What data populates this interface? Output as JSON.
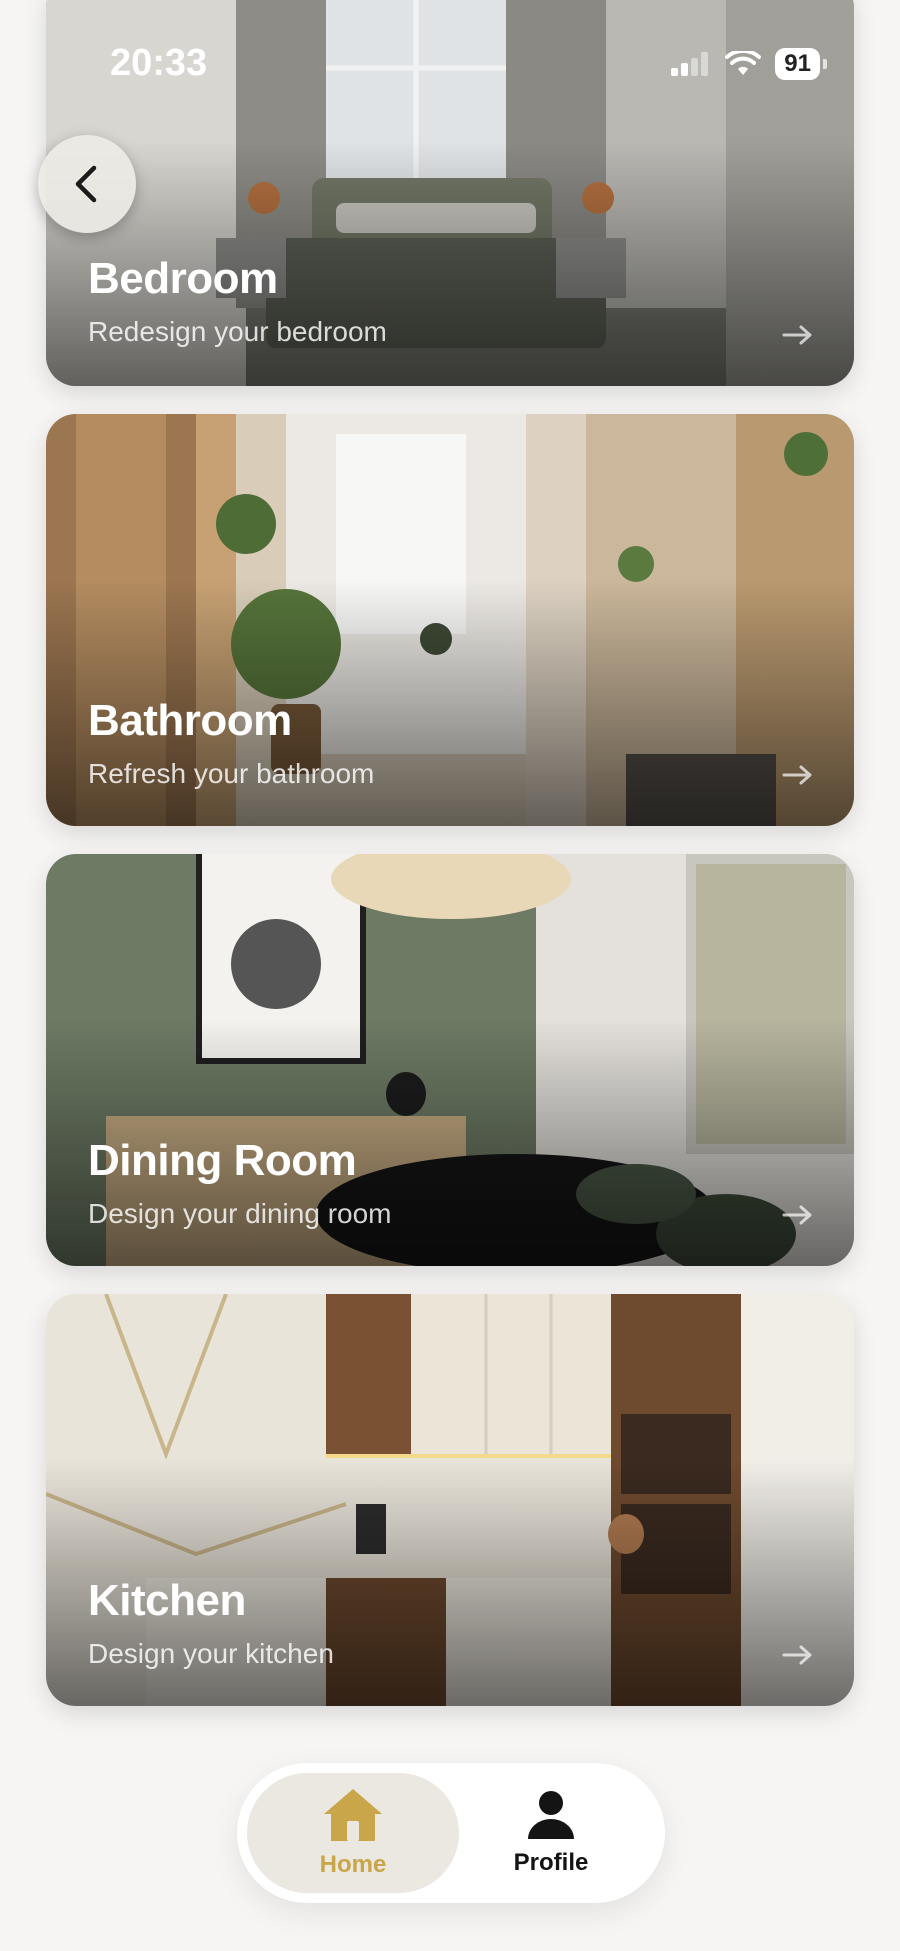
{
  "status_bar": {
    "time": "20:33",
    "battery": "91"
  },
  "navigation": {
    "back_icon": "chevron-left-icon"
  },
  "rooms": [
    {
      "title": "Bedroom",
      "subtitle": "Redesign your bedroom",
      "arrow_icon": "arrow-right-icon"
    },
    {
      "title": "Bathroom",
      "subtitle": "Refresh your bathroom",
      "arrow_icon": "arrow-right-icon"
    },
    {
      "title": "Dining Room",
      "subtitle": "Design your dining room",
      "arrow_icon": "arrow-right-icon"
    },
    {
      "title": "Kitchen",
      "subtitle": "Design your kitchen",
      "arrow_icon": "arrow-right-icon"
    }
  ],
  "tab_bar": {
    "home_label": "Home",
    "profile_label": "Profile",
    "active": "Home"
  },
  "colors": {
    "accent": "#c9a64a",
    "background": "#f6f5f3"
  }
}
